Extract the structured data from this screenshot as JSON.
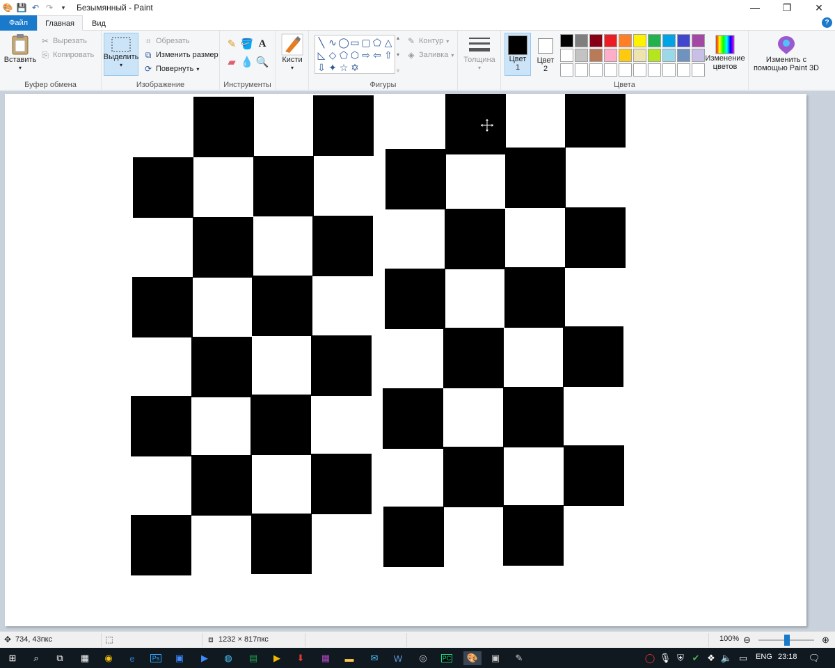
{
  "window": {
    "title": "Безымянный - Paint",
    "minimize_icon": "minimize-icon",
    "maximize_icon": "restore-icon",
    "close_icon": "close-icon"
  },
  "tabs": {
    "file": "Файл",
    "home": "Главная",
    "view": "Вид"
  },
  "ribbon": {
    "clipboard": {
      "label": "Буфер обмена",
      "paste": "Вставить",
      "cut": "Вырезать",
      "copy": "Копировать"
    },
    "image": {
      "label": "Изображение",
      "select": "Выделить",
      "crop": "Обрезать",
      "resize": "Изменить размер",
      "rotate": "Повернуть"
    },
    "tools": {
      "label": "Инструменты"
    },
    "brushes": "Кисти",
    "shapes": {
      "label": "Фигуры",
      "outline": "Контур",
      "fill": "Заливка"
    },
    "thickness": "Толщина",
    "colors": {
      "label": "Цвета",
      "color1": "Цвет 1",
      "color2": "Цвет 2",
      "edit_colors": "Изменение цветов",
      "paint3d": "Изменить с помощью Paint 3D",
      "color1_value": "#000000",
      "color2_value": "#ffffff",
      "palette": [
        "#000000",
        "#7f7f7f",
        "#880015",
        "#ed1c24",
        "#ff7f27",
        "#fff200",
        "#22b14c",
        "#00a2e8",
        "#3f48cc",
        "#a349a4",
        "#ffffff",
        "#c3c3c3",
        "#b97a57",
        "#ffaec9",
        "#ffc90e",
        "#efe4b0",
        "#b5e61d",
        "#99d9ea",
        "#7092be",
        "#c8bfe7",
        "#ffffff",
        "#ffffff",
        "#ffffff",
        "#ffffff",
        "#ffffff",
        "#ffffff",
        "#ffffff",
        "#ffffff",
        "#ffffff",
        "#ffffff"
      ]
    }
  },
  "status": {
    "cursor_pos": "734, 43пкс",
    "canvas_size": "1232 × 817пкс",
    "zoom": "100%"
  },
  "taskbar": {
    "language": "ENG",
    "time": "23:18"
  }
}
